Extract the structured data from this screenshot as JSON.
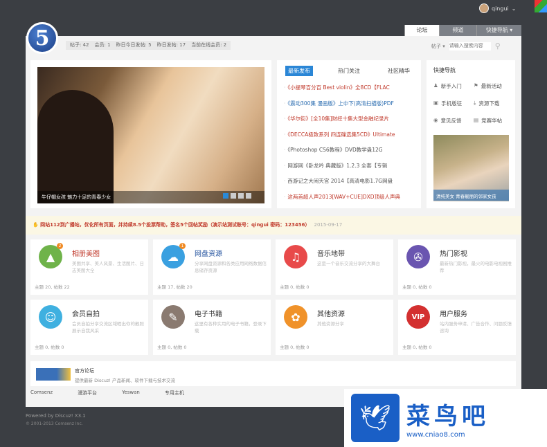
{
  "header": {
    "username": "qingui",
    "nav_tabs": [
      "论坛",
      "频道",
      "快捷导航 ▾"
    ],
    "logo_text": "5"
  },
  "stats": [
    "帖子: 42",
    "会员: 1",
    "昨日今日发帖: 5",
    "昨日发帖: 17",
    "当前在线会员: 2"
  ],
  "search": {
    "type": "帖子 ▾",
    "placeholder": "请输入搜索内容"
  },
  "slider": {
    "caption": "牛仔帽女孩 魅力十足的青春少女",
    "active_dot": 1,
    "dots": 4
  },
  "news": {
    "tabs": [
      "最新发布",
      "热门关注",
      "社区精华"
    ],
    "items": [
      {
        "text": "《小提琴百分百 Best violin》全8CD【FLAC",
        "color": "#c0392b"
      },
      {
        "text": "《震动300集 漫画版》上中下(高清扫描版)PDF",
        "color": "#2a6cb0"
      },
      {
        "text": "《华尔街》[全10集]财经十集大型金融纪录片",
        "color": "#c0392b"
      },
      {
        "text": "《DECCA极致系列 四连碟选集5CD》Ultimate",
        "color": "#c0392b"
      },
      {
        "text": "《Photoshop CS6教程》DVD教学盘12G",
        "color": "#555"
      },
      {
        "text": "网游网《卧龙吟 典藏版》1.2.3 全套【专辑",
        "color": "#555"
      },
      {
        "text": "西游记之大闹天宫 2014【高清电影1.7G网盘",
        "color": "#555"
      },
      {
        "text": "这两首超人声2013[WAV+CUE]DXD顶级人声典",
        "color": "#c0392b"
      }
    ]
  },
  "quick": {
    "title": "快捷导航",
    "items": [
      {
        "icon": "user-icon",
        "glyph": "♟",
        "label": "新手入门"
      },
      {
        "icon": "flag-icon",
        "glyph": "⚑",
        "label": "最新活动"
      },
      {
        "icon": "phone-icon",
        "glyph": "▣",
        "label": "手机版征"
      },
      {
        "icon": "download-icon",
        "glyph": "⤓",
        "label": "资源下载"
      },
      {
        "icon": "feedback-icon",
        "glyph": "◉",
        "label": "意见反馈"
      },
      {
        "icon": "store-icon",
        "glyph": "▤",
        "label": "竞赛华帖"
      }
    ],
    "image_caption": "清纯美女 青春靓丽的邻家女孩"
  },
  "notice": {
    "text": "✋ 网站112到广播站，优化所有页面，并持续8.5个投票帮助，签名5个回帖奖励（演示站测试账号：qingui 密码：123456）",
    "date": "2015-09-17"
  },
  "forums": [
    {
      "title": "相册美图",
      "title_color": "#c0392b",
      "desc": "美图共享、美人风景、生活图片、日志美图大全",
      "stats": "主题 20, 帖数 22",
      "icon": "image-icon",
      "glyph": "▲",
      "color": "#6fb34a",
      "badge": "2"
    },
    {
      "title": "网盘资源",
      "title_color": "#1f4f9c",
      "desc": "分享网盘资源和各类应用网络数据信息储存资源",
      "stats": "主题 17, 帖数 20",
      "icon": "cloud-icon",
      "glyph": "☁",
      "color": "#3aa0e0",
      "badge": "1"
    },
    {
      "title": "音乐地带",
      "title_color": "#333",
      "desc": "这是一个音乐交流分享的大舞台",
      "stats": "主题 0, 帖数 0",
      "icon": "music-icon",
      "glyph": "♫",
      "color": "#e84a4a",
      "badge": ""
    },
    {
      "title": "热门影视",
      "title_color": "#333",
      "desc": "最新热门影视，最火的电影电视剧推荐",
      "stats": "主题 0, 帖数 0",
      "icon": "film-icon",
      "glyph": "✇",
      "color": "#6a55b0",
      "badge": ""
    },
    {
      "title": "会员自拍",
      "title_color": "#333",
      "desc": "会员自拍分享交流区域晒出你的靓照展示自我风采",
      "stats": "主题 0, 帖数 0",
      "icon": "portrait-icon",
      "glyph": "☺",
      "color": "#3fb0e0",
      "badge": ""
    },
    {
      "title": "电子书籍",
      "title_color": "#333",
      "desc": "这里有各种实用的电子书籍，登录下载",
      "stats": "主题 0, 帖数 0",
      "icon": "book-icon",
      "glyph": "✎",
      "color": "#8a7a70",
      "badge": ""
    },
    {
      "title": "其他资源",
      "title_color": "#333",
      "desc": "其他资源分享",
      "stats": "主题 0, 帖数 0",
      "icon": "leaf-icon",
      "glyph": "✿",
      "color": "#f0922a",
      "badge": ""
    },
    {
      "title": "用户服务",
      "title_color": "#333",
      "desc": "站内服务申请、广告合作、问题反馈咨询",
      "stats": "主题 0, 帖数 0",
      "icon": "vip-icon",
      "glyph": "VIP",
      "color": "#d33030",
      "badge": ""
    }
  ],
  "friend_link": {
    "logo": "Discuz!",
    "name": "官方论坛",
    "desc": "提供最新 Discuz! 产品新闻、软件下载与技术交流"
  },
  "footer": {
    "links": [
      "Comsenz",
      "漫游平台",
      "Yeswan",
      "专用主机"
    ],
    "powered": "Powered by Discuz! X3.1",
    "copyright": "© 2001-2013 Comsenz Inc."
  },
  "watermark": {
    "title": "菜鸟吧",
    "url": "www.cniao8.com"
  }
}
